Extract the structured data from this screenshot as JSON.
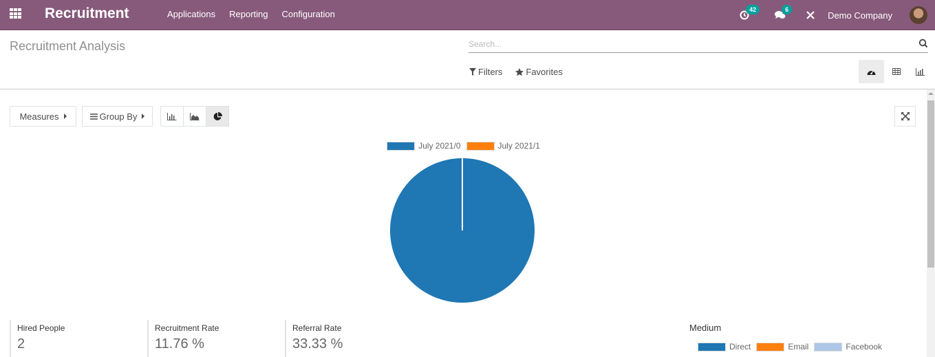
{
  "navbar": {
    "brand": "Recruitment",
    "menu": [
      "Applications",
      "Reporting",
      "Configuration"
    ],
    "activity_count": "42",
    "message_count": "6",
    "company": "Demo Company"
  },
  "control_panel": {
    "breadcrumb": "Recruitment Analysis",
    "search_placeholder": "Search...",
    "filters_label": "Filters",
    "favorites_label": "Favorites",
    "views": [
      "dashboard",
      "pivot",
      "graph"
    ],
    "active_view": "dashboard"
  },
  "toolbar": {
    "measures_label": "Measures",
    "groupby_label": "Group By",
    "chart_types": [
      "bar",
      "line",
      "pie"
    ],
    "active_chart_type": "pie"
  },
  "chart_data": {
    "type": "pie",
    "categories": [
      "July 2021/0",
      "July 2021/1"
    ],
    "values": [
      100,
      0
    ],
    "colors": [
      "#1f77b4",
      "#ff7f0e"
    ],
    "legend": "top-center",
    "title": ""
  },
  "kpis": [
    {
      "label": "Hired People",
      "value": "2"
    },
    {
      "label": "Recruitment Rate",
      "value": "11.76 %"
    },
    {
      "label": "Referral Rate",
      "value": "33.33 %"
    }
  ],
  "medium": {
    "title": "Medium",
    "legend": [
      {
        "label": "Direct",
        "color": "#1f77b4"
      },
      {
        "label": "Email",
        "color": "#ff7f0e"
      },
      {
        "label": "Facebook",
        "color": "#aec7e8"
      }
    ]
  }
}
